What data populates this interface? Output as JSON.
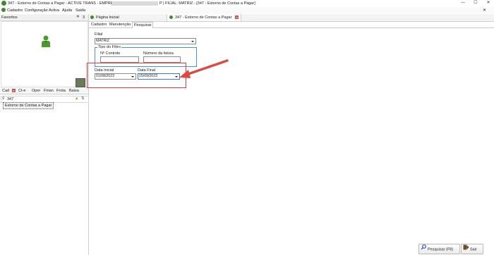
{
  "window": {
    "title_left": "347 - Estorno de Contas a Pagar - ACTIVE TRANS - EMPRESA:",
    "title_right": "P | FILIAL: MATRIZ - [347 - Estorno de Contas a Pagar]",
    "controls": [
      "—",
      "☐",
      "✕"
    ]
  },
  "menu": {
    "items": [
      "Cadastro",
      "Configuração Activa",
      "Ajuda",
      "Saida"
    ]
  },
  "left_panel": {
    "favorites_label": "Favoritos",
    "favorites_count": "3",
    "tabs": [
      "Cad",
      "Ct-e",
      "Oper",
      "Finan",
      "Frota",
      "Baixa"
    ],
    "search_value": "347",
    "tree_item": "Estorno de Contas a Pagar"
  },
  "doc_tabs": [
    "Página Inicial",
    "347 - Estorno de Contas a Pagar"
  ],
  "sub_tabs": [
    "Cadastro",
    "Manutenção",
    "Pesquisar"
  ],
  "form": {
    "filial_label": "Filial",
    "filial_value": "MATRIZ",
    "tipo_filtro_label": "Tipo do Filtro",
    "controle_label": "Nº Controle",
    "fatura_label": "Número da fatura",
    "controle_value": "",
    "fatura_value": "",
    "data_inicial_label": "Data Inicial",
    "data_inicial_value": "01/08/2023",
    "data_final_label": "Data Final",
    "data_final_value": "15/09/2023"
  },
  "buttons": {
    "pesquisar": "Pesquisar (F8)",
    "sair": "Sair"
  },
  "colors": {
    "highlight_box": "#e23c3c",
    "arrow": "#d94b43",
    "group_border": "#4a90d9",
    "app_icon": "#3f8a2c"
  }
}
